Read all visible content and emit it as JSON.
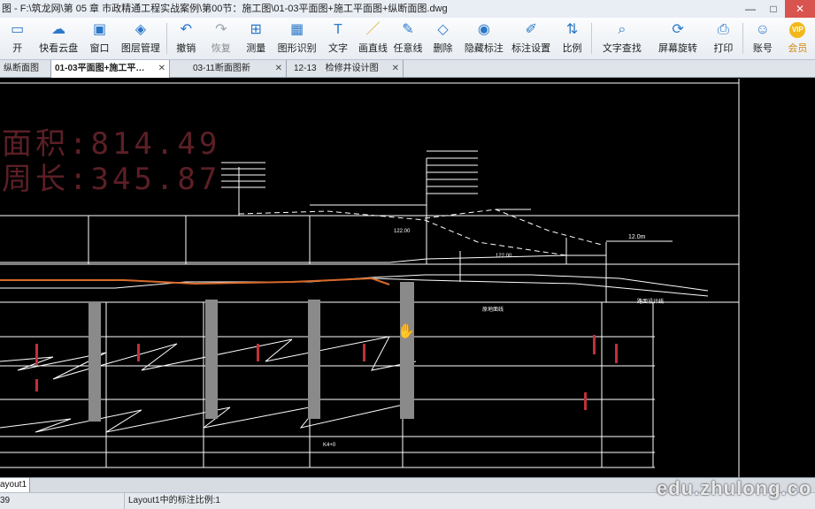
{
  "window": {
    "title": "图 - F:\\筑龙网\\第 05 章 市政精通工程实战案例\\第00节：施工图\\01-03平面图+施工平面图+纵断面图.dwg",
    "controls": [
      "—",
      "□",
      "✕"
    ]
  },
  "toolbar": {
    "items": [
      {
        "label": "开",
        "icon": "open-icon"
      },
      {
        "label": "快看云盘",
        "icon": "cloud-icon"
      },
      {
        "label": "窗口",
        "icon": "window-icon"
      },
      {
        "label": "图层管理",
        "icon": "layers-icon"
      },
      {
        "label": "撤销",
        "icon": "undo-icon"
      },
      {
        "label": "恢复",
        "icon": "redo-icon"
      },
      {
        "label": "测量",
        "icon": "measure-icon"
      },
      {
        "label": "图形识别",
        "icon": "shape-recognize-icon"
      },
      {
        "label": "文字",
        "icon": "text-icon"
      },
      {
        "label": "画直线",
        "icon": "line-icon"
      },
      {
        "label": "任意线",
        "icon": "freehand-icon"
      },
      {
        "label": "删除",
        "icon": "eraser-icon"
      },
      {
        "label": "隐藏标注",
        "icon": "eye-icon"
      },
      {
        "label": "标注设置",
        "icon": "annotation-settings-icon"
      },
      {
        "label": "比例",
        "icon": "scale-icon"
      },
      {
        "label": "文字查找",
        "icon": "text-search-icon"
      },
      {
        "label": "屏幕旋转",
        "icon": "rotate-icon"
      },
      {
        "label": "打印",
        "icon": "print-icon"
      },
      {
        "label": "账号",
        "icon": "account-icon"
      },
      {
        "label": "会员",
        "icon": "vip-icon",
        "badge": "VIP"
      }
    ]
  },
  "tabs": [
    {
      "label": "纵断面图",
      "active": false
    },
    {
      "label": "01-03平面图+施工平…",
      "active": true
    },
    {
      "label": "03-11断面图新",
      "active": false
    },
    {
      "label": "12-13　检修井设计图",
      "active": false
    }
  ],
  "canvas": {
    "area_lines": [
      "面积:814.49",
      "周长:345.87"
    ],
    "labels": {
      "dim": "12.0m",
      "elev1": "122.00",
      "elev2": "122.00",
      "road": "路面设计线",
      "note": "原地面线",
      "bottom": "K4+0"
    },
    "colors": {
      "line": "#ffffff",
      "accent_line": "#d86a2a",
      "area_text": "#5c1f26",
      "red_mark": "#c0303a"
    }
  },
  "layout": {
    "tab": "ayout1"
  },
  "status": {
    "coord": "39",
    "scale": "Layout1中的标注比例:1"
  },
  "watermark": "edu.zhulong.co"
}
